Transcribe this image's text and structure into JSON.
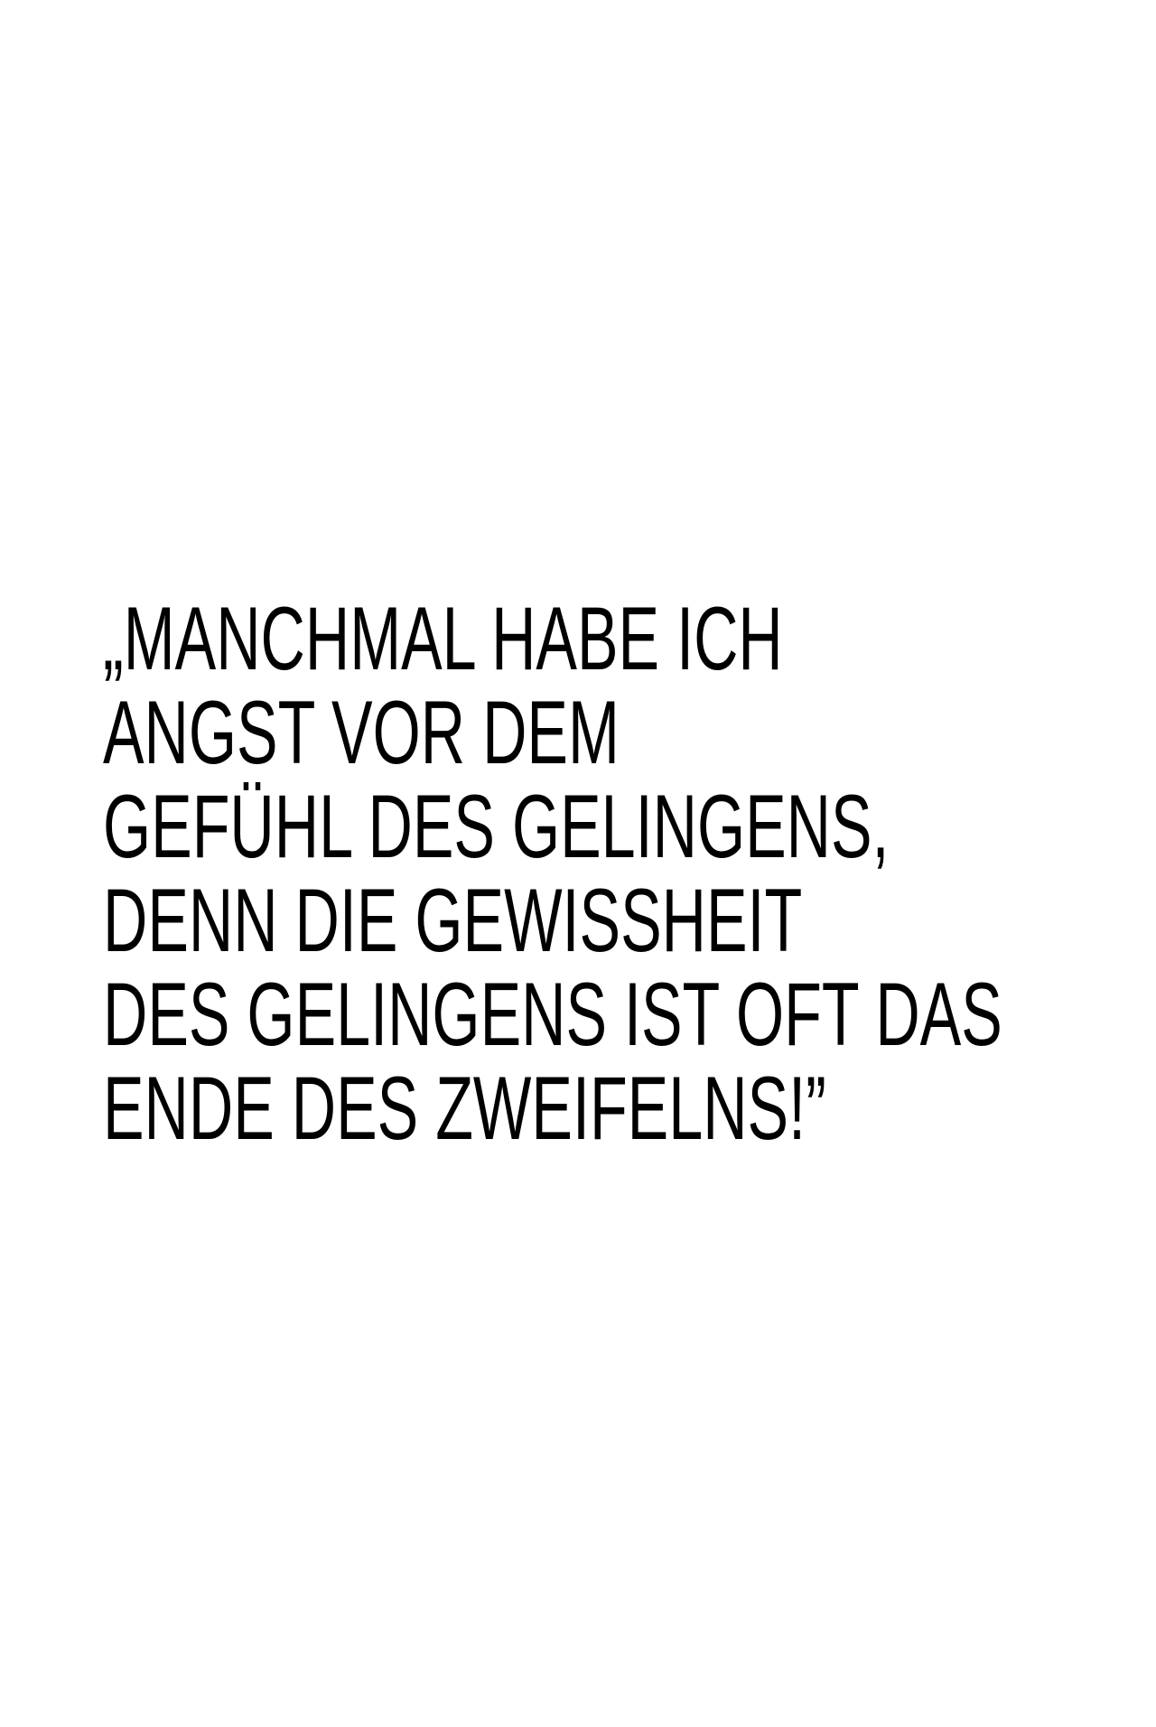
{
  "quote": {
    "lines": [
      "„MANCHMAL HABE ICH",
      "ANGST VOR DEM",
      "GEFÜHL DES GELINGENS,",
      "DENN DIE GEWISSHEIT",
      "DES GELINGENS IST OFT DAS",
      "ENDE DES ZWEIFELNS!”"
    ]
  },
  "colors": {
    "text": "#000000",
    "background": "#ffffff"
  }
}
